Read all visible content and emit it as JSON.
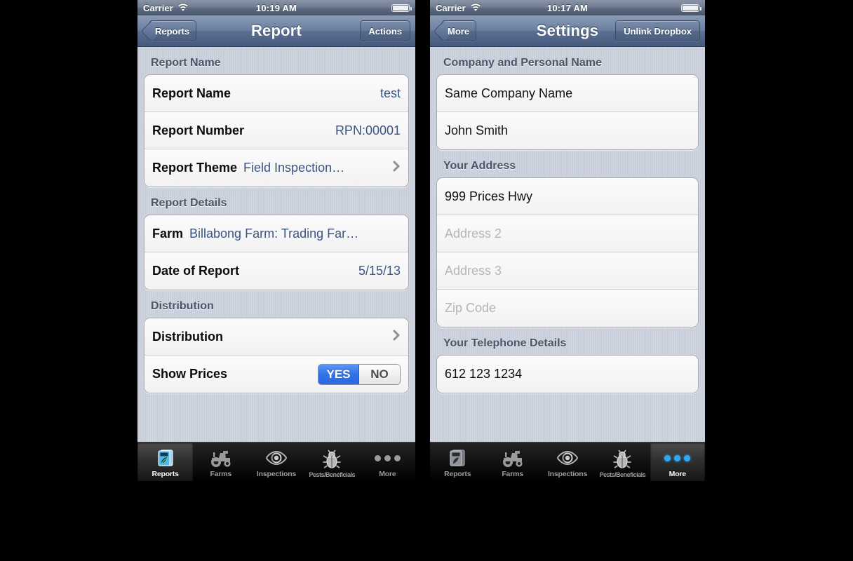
{
  "screens": [
    {
      "id": "report-screen",
      "status_bar": {
        "carrier": "Carrier",
        "time": "10:19 AM",
        "wifi_icon": "wifi-icon",
        "battery_icon": "battery-icon"
      },
      "nav": {
        "back_label": "Reports",
        "title": "Report",
        "action_label": "Actions"
      },
      "sections": [
        {
          "header": "Report Name",
          "rows": [
            {
              "label": "Report Name",
              "value": "test",
              "type": "value"
            },
            {
              "label": "Report Number",
              "value": "RPN:00001",
              "type": "value"
            },
            {
              "label": "Report Theme",
              "value": "Field Inspection…",
              "type": "inline-disclosure"
            }
          ]
        },
        {
          "header": "Report Details",
          "rows": [
            {
              "label": "Farm",
              "value": "Billabong Farm: Trading Far…",
              "type": "inline"
            },
            {
              "label": "Date of Report",
              "value": "5/15/13",
              "type": "value"
            }
          ]
        },
        {
          "header": "Distribution",
          "rows": [
            {
              "label": "Distribution",
              "value": "",
              "type": "disclosure"
            },
            {
              "label": "Show Prices",
              "type": "segmented",
              "options": [
                "YES",
                "NO"
              ],
              "selected": "YES"
            }
          ]
        }
      ],
      "tabs": [
        {
          "label": "Reports",
          "icon": "report-book-icon",
          "selected": true
        },
        {
          "label": "Farms",
          "icon": "tractor-icon",
          "selected": false
        },
        {
          "label": "Inspections",
          "icon": "eye-icon",
          "selected": false
        },
        {
          "label": "Pests/Beneficials",
          "icon": "bug-icon",
          "selected": false
        },
        {
          "label": "More",
          "icon": "three-dots-icon",
          "selected": false
        }
      ]
    },
    {
      "id": "settings-screen",
      "status_bar": {
        "carrier": "Carrier",
        "time": "10:17 AM",
        "wifi_icon": "wifi-icon",
        "battery_icon": "battery-icon"
      },
      "nav": {
        "back_label": "More",
        "title": "Settings",
        "action_label": "Unlink Dropbox"
      },
      "sections": [
        {
          "header": "Company and Personal Name",
          "rows": [
            {
              "text": "Same Company Name",
              "type": "text",
              "placeholder": false
            },
            {
              "text": "John Smith",
              "type": "text",
              "placeholder": false
            }
          ]
        },
        {
          "header": "Your Address",
          "rows": [
            {
              "text": "999 Prices Hwy",
              "type": "text",
              "placeholder": false
            },
            {
              "text": "Address 2",
              "type": "text",
              "placeholder": true
            },
            {
              "text": "Address 3",
              "type": "text",
              "placeholder": true
            },
            {
              "text": "Zip Code",
              "type": "text",
              "placeholder": true
            }
          ]
        },
        {
          "header": "Your Telephone Details",
          "rows": [
            {
              "text": "612 123 1234",
              "type": "text",
              "placeholder": false
            }
          ]
        }
      ],
      "tabs": [
        {
          "label": "Reports",
          "icon": "report-book-icon",
          "selected": false
        },
        {
          "label": "Farms",
          "icon": "tractor-icon",
          "selected": false
        },
        {
          "label": "Inspections",
          "icon": "eye-icon",
          "selected": false
        },
        {
          "label": "Pests/Beneficials",
          "icon": "bug-icon",
          "selected": false
        },
        {
          "label": "More",
          "icon": "three-dots-icon",
          "selected": true
        }
      ]
    }
  ],
  "colors": {
    "accent_blue": "#2f72ea",
    "nav_blue": "#5a6f92",
    "section_header": "#4a5568",
    "value_text": "#3b5482",
    "placeholder": "#b5b5b5",
    "tab_selected": "#ffffff",
    "tab_inactive": "#9b9b9b",
    "tab_dot_active": "#2fa8f5",
    "backdrop": "#000000"
  }
}
